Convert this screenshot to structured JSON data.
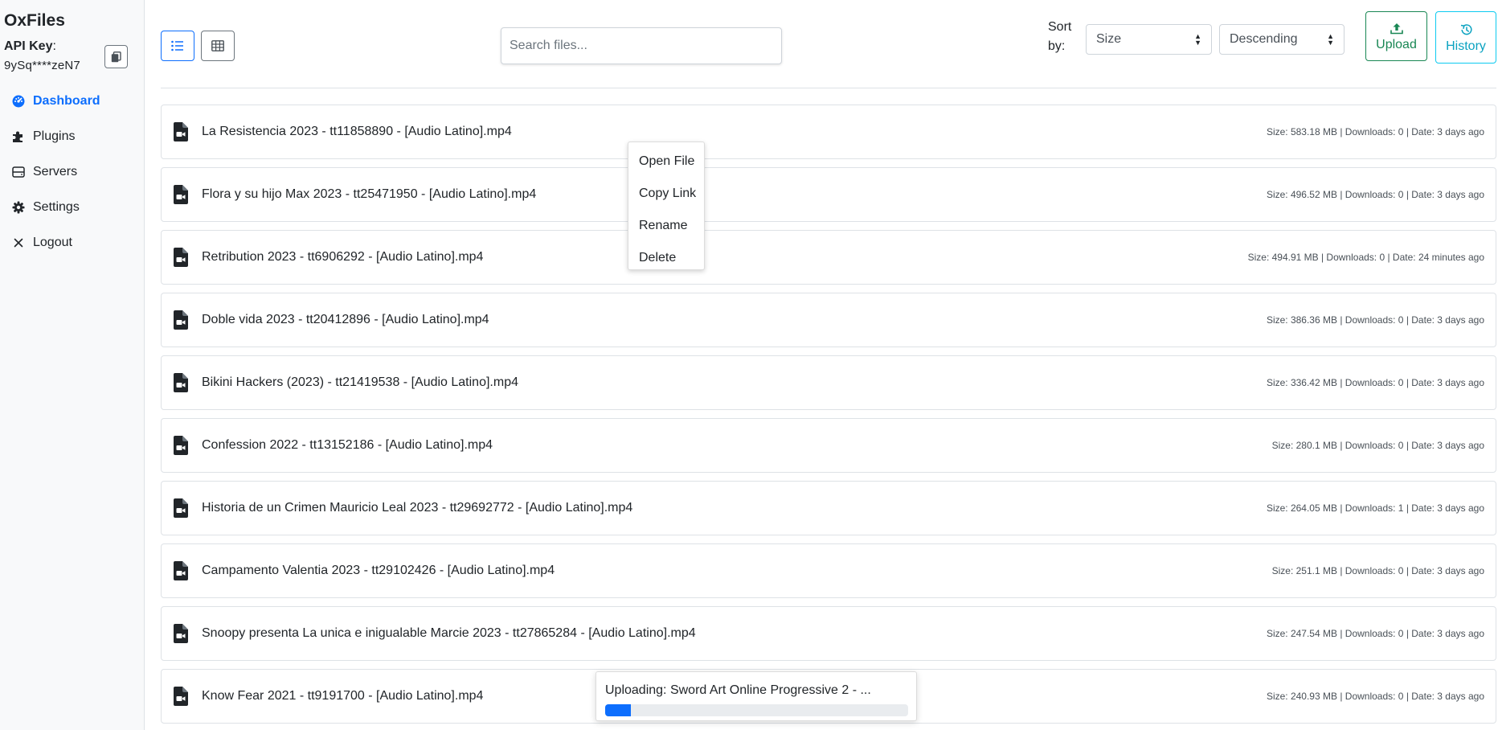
{
  "sidebar": {
    "brand": "OxFiles",
    "api_key_label": "API Key",
    "api_key_value": "9ySq****zeN7",
    "items": [
      {
        "label": "Dashboard",
        "icon": "dashboard-icon",
        "active": true
      },
      {
        "label": "Plugins",
        "icon": "puzzle-icon",
        "active": false
      },
      {
        "label": "Servers",
        "icon": "server-icon",
        "active": false
      },
      {
        "label": "Settings",
        "icon": "gear-icon",
        "active": false
      },
      {
        "label": "Logout",
        "icon": "close-icon",
        "active": false
      }
    ]
  },
  "toolbar": {
    "search_placeholder": "Search files...",
    "sort_label": "Sort by:",
    "sort_field": "Size",
    "sort_order": "Descending",
    "upload_label": "Upload",
    "history_label": "History"
  },
  "files": [
    {
      "name": "La Resistencia 2023 - tt11858890 - [Audio Latino].mp4",
      "meta": "Size: 583.18 MB | Downloads: 0 | Date: 3 days ago"
    },
    {
      "name": "Flora y su hijo Max 2023 - tt25471950 - [Audio Latino].mp4",
      "meta": "Size: 496.52 MB | Downloads: 0 | Date: 3 days ago"
    },
    {
      "name": "Retribution 2023 - tt6906292 - [Audio Latino].mp4",
      "meta": "Size: 494.91 MB | Downloads: 0 | Date: 24 minutes ago"
    },
    {
      "name": "Doble vida 2023 - tt20412896 - [Audio Latino].mp4",
      "meta": "Size: 386.36 MB | Downloads: 0 | Date: 3 days ago"
    },
    {
      "name": "Bikini Hackers (2023) - tt21419538 - [Audio Latino].mp4",
      "meta": "Size: 336.42 MB | Downloads: 0 | Date: 3 days ago"
    },
    {
      "name": "Confession 2022 - tt13152186 - [Audio Latino].mp4",
      "meta": "Size: 280.1 MB | Downloads: 0 | Date: 3 days ago"
    },
    {
      "name": "Historia de un Crimen Mauricio Leal 2023 - tt29692772 - [Audio Latino].mp4",
      "meta": "Size: 264.05 MB | Downloads: 1 | Date: 3 days ago"
    },
    {
      "name": "Campamento Valentia 2023 - tt29102426 - [Audio Latino].mp4",
      "meta": "Size: 251.1 MB | Downloads: 0 | Date: 3 days ago"
    },
    {
      "name": "Snoopy presenta La unica e inigualable Marcie 2023 - tt27865284 - [Audio Latino].mp4",
      "meta": "Size: 247.54 MB | Downloads: 0 | Date: 3 days ago"
    },
    {
      "name": "Know Fear 2021 - tt9191700 - [Audio Latino].mp4",
      "meta": "Size: 240.93 MB | Downloads: 0 | Date: 3 days ago"
    }
  ],
  "context_menu": {
    "items": [
      "Open File",
      "Copy Link",
      "Rename",
      "Delete"
    ]
  },
  "upload_toast": {
    "text": "Uploading: Sword Art Online Progressive 2 - ...",
    "progress_percent": 8.5
  },
  "colors": {
    "primary": "#0d6efd",
    "success": "#198754",
    "info": "#0dcaf0"
  }
}
